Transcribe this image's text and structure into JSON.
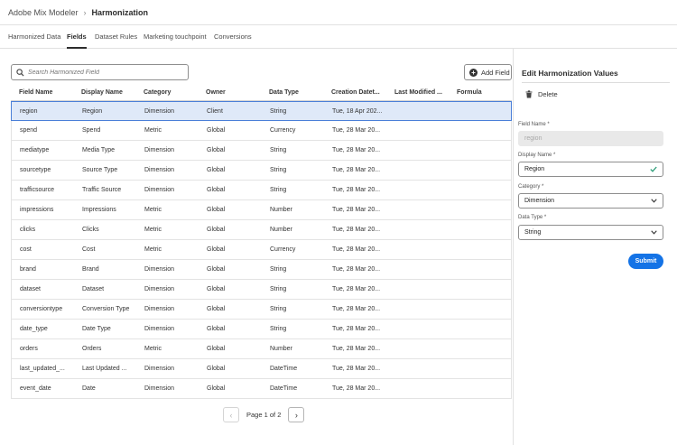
{
  "breadcrumb": {
    "app": "Adobe Mix Modeler",
    "current": "Harmonization"
  },
  "tabs": [
    {
      "label": "Harmonized Data",
      "active": false
    },
    {
      "label": "Fields",
      "active": true
    },
    {
      "label": "Dataset Rules",
      "active": false
    },
    {
      "label": "Marketing touchpoint",
      "active": false
    },
    {
      "label": "Conversions",
      "active": false
    }
  ],
  "search": {
    "placeholder": "Search Harmonized Field",
    "icon": "search-icon"
  },
  "add_field": {
    "label": "Add Field",
    "icon": "plus-circle-icon"
  },
  "table": {
    "columns": [
      "Field Name",
      "Display Name",
      "Category",
      "Owner",
      "Data Type",
      "Creation Datet...",
      "Last Modified ...",
      "Formula"
    ],
    "rows": [
      [
        "region",
        "Region",
        "Dimension",
        "Client",
        "String",
        "Tue, 18 Apr 202...",
        "",
        ""
      ],
      [
        "spend",
        "Spend",
        "Metric",
        "Global",
        "Currency",
        "Tue, 28 Mar 20...",
        "",
        ""
      ],
      [
        "mediatype",
        "Media Type",
        "Dimension",
        "Global",
        "String",
        "Tue, 28 Mar 20...",
        "",
        ""
      ],
      [
        "sourcetype",
        "Source Type",
        "Dimension",
        "Global",
        "String",
        "Tue, 28 Mar 20...",
        "",
        ""
      ],
      [
        "trafficsource",
        "Traffic Source",
        "Dimension",
        "Global",
        "String",
        "Tue, 28 Mar 20...",
        "",
        ""
      ],
      [
        "impressions",
        "Impressions",
        "Metric",
        "Global",
        "Number",
        "Tue, 28 Mar 20...",
        "",
        ""
      ],
      [
        "clicks",
        "Clicks",
        "Metric",
        "Global",
        "Number",
        "Tue, 28 Mar 20...",
        "",
        ""
      ],
      [
        "cost",
        "Cost",
        "Metric",
        "Global",
        "Currency",
        "Tue, 28 Mar 20...",
        "",
        ""
      ],
      [
        "brand",
        "Brand",
        "Dimension",
        "Global",
        "String",
        "Tue, 28 Mar 20...",
        "",
        ""
      ],
      [
        "dataset",
        "Dataset",
        "Dimension",
        "Global",
        "String",
        "Tue, 28 Mar 20...",
        "",
        ""
      ],
      [
        "conversiontype",
        "Conversion Type",
        "Dimension",
        "Global",
        "String",
        "Tue, 28 Mar 20...",
        "",
        ""
      ],
      [
        "date_type",
        "Date Type",
        "Dimension",
        "Global",
        "String",
        "Tue, 28 Mar 20...",
        "",
        ""
      ],
      [
        "orders",
        "Orders",
        "Metric",
        "Global",
        "Number",
        "Tue, 28 Mar 20...",
        "",
        ""
      ],
      [
        "last_updated_...",
        "Last Updated ...",
        "Dimension",
        "Global",
        "DateTime",
        "Tue, 28 Mar 20...",
        "",
        ""
      ],
      [
        "event_date",
        "Date",
        "Dimension",
        "Global",
        "DateTime",
        "Tue, 28 Mar 20...",
        "",
        ""
      ]
    ],
    "selected_row": 0
  },
  "pagination": {
    "label": "Page 1 of 2",
    "prev_icon": "chevron-left-icon",
    "next_icon": "chevron-right-icon"
  },
  "panel": {
    "title": "Edit Harmonization Values",
    "delete_label": "Delete",
    "field_name": {
      "label": "Field Name",
      "value": "region"
    },
    "display_name": {
      "label": "Display Name",
      "value": "Region"
    },
    "category": {
      "label": "Category",
      "value": "Dimension"
    },
    "data_type": {
      "label": "Data Type",
      "value": "String"
    },
    "required_marker": "*",
    "submit_label": "Submit"
  },
  "colors": {
    "accent": "#1473e6",
    "selected_row_bg": "#dfe9f8",
    "selected_row_border": "#4a7fd8",
    "valid_check": "#2d9d78"
  }
}
